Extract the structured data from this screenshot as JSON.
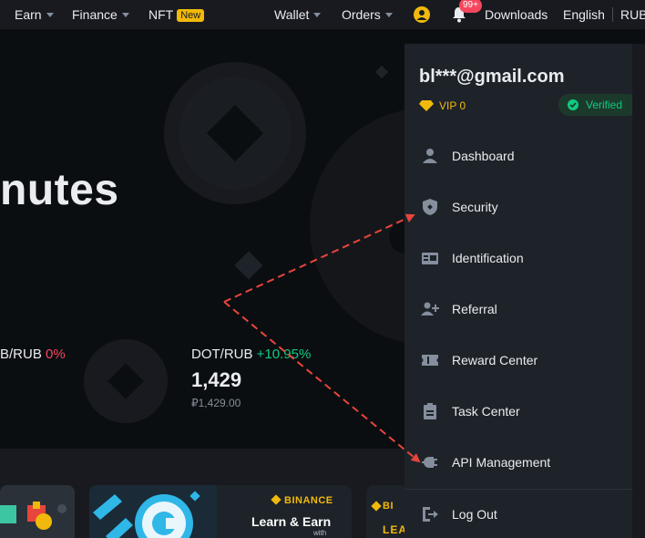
{
  "nav": {
    "earn": "Earn",
    "finance": "Finance",
    "nft": "NFT",
    "nft_badge": "New",
    "wallet": "Wallet",
    "orders": "Orders",
    "notifications_badge": "99+",
    "downloads": "Downloads",
    "language": "English",
    "currency": "RUB"
  },
  "hero": {
    "title_fragment": "nutes",
    "ticker1": {
      "pair": "B/RUB",
      "change": "0%"
    },
    "ticker2": {
      "pair": "DOT/RUB",
      "change": "+10.95%",
      "price": "1,429",
      "fiat_price": "₽1,429.00"
    }
  },
  "banners": {
    "brand": "BINANCE",
    "headline": "Learn & Earn",
    "sub": "with",
    "brand_short": "BI",
    "partial": "LEA"
  },
  "account_menu": {
    "email": "bl***@gmail.com",
    "vip": "VIP 0",
    "verified": "Verified",
    "items": [
      {
        "label": "Dashboard",
        "icon": "person-icon"
      },
      {
        "label": "Security",
        "icon": "shield-icon"
      },
      {
        "label": "Identification",
        "icon": "id-card-icon"
      },
      {
        "label": "Referral",
        "icon": "add-user-icon"
      },
      {
        "label": "Reward Center",
        "icon": "ticket-icon"
      },
      {
        "label": "Task Center",
        "icon": "clipboard-icon"
      },
      {
        "label": "API Management",
        "icon": "plug-icon"
      },
      {
        "label": "Log Out",
        "icon": "logout-icon"
      }
    ]
  },
  "colors": {
    "accent": "#f0b90b",
    "positive": "#0ecb81",
    "negative": "#f6465d",
    "annotation": "#e8453c"
  }
}
